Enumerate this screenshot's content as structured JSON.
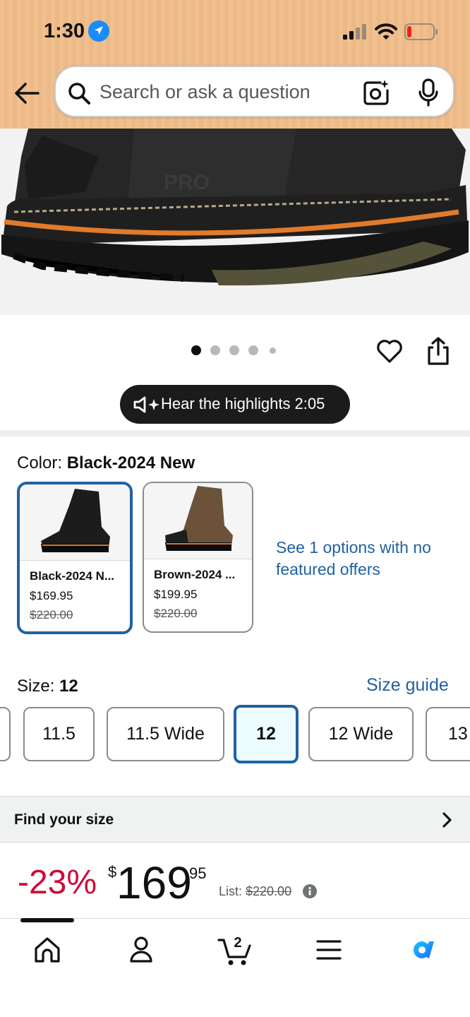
{
  "status_bar": {
    "time": "1:30",
    "battery_level": "low"
  },
  "search": {
    "placeholder": "Search or ask a question",
    "icons": [
      "back-arrow-icon",
      "search-icon",
      "camera-icon",
      "mic-icon"
    ]
  },
  "gallery": {
    "dot_count": 5,
    "active_index": 0,
    "icons": [
      "heart-icon",
      "share-icon"
    ]
  },
  "highlights": {
    "label": "Hear the highlights 2:05"
  },
  "color": {
    "label": "Color: ",
    "selected": "Black-2024 New",
    "options": [
      {
        "name": "Black-2024 N...",
        "price": "$169.95",
        "list_price": "$220.00",
        "selected": true
      },
      {
        "name": "Brown-2024 ...",
        "price": "$199.95",
        "list_price": "$220.00",
        "selected": false
      }
    ],
    "more_link": "See 1 options with no featured offers"
  },
  "size": {
    "label": "Size: ",
    "selected": "12",
    "guide_link": "Size guide",
    "options": [
      "11.5",
      "11.5 Wide",
      "12",
      "12 Wide",
      "13"
    ]
  },
  "find_size": {
    "label": "Find your size"
  },
  "price": {
    "discount": "-23%",
    "currency": "$",
    "whole": "169",
    "fraction": "95",
    "list_label": "List: ",
    "list_value": "$220.00"
  },
  "tab_bar": {
    "cart_count": "2",
    "tabs": [
      "home-icon",
      "account-icon",
      "cart-icon",
      "menu-icon",
      "rufus-icon"
    ]
  },
  "colors": {
    "header_bg": "#f1c08f",
    "link_blue": "#2162a1",
    "deal_red": "#cc0c39",
    "selected_fill": "#edfdff"
  }
}
